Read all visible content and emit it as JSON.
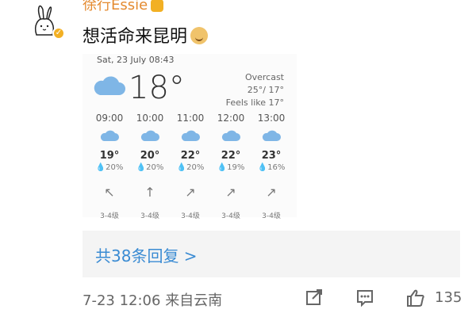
{
  "post": {
    "username": "徐行Essie",
    "comment_text": "想活命来昆明",
    "verified": true
  },
  "weather_card": {
    "date": "Sat, 23 July 08:43",
    "current_temp": "18°",
    "condition": "Overcast",
    "hi_lo": "25°/ 17°",
    "feels_like": "Feels like 17°",
    "hours": [
      {
        "time": "09:00",
        "temp": "19°",
        "rain": "20%",
        "wind_dir": "NW",
        "wind": "3-4级"
      },
      {
        "time": "10:00",
        "temp": "20°",
        "rain": "20%",
        "wind_dir": "N",
        "wind": "3-4级"
      },
      {
        "time": "11:00",
        "temp": "22°",
        "rain": "20%",
        "wind_dir": "NE",
        "wind": "3-4级"
      },
      {
        "time": "12:00",
        "temp": "22°",
        "rain": "19%",
        "wind_dir": "NE",
        "wind": "3-4级"
      },
      {
        "time": "13:00",
        "temp": "23°",
        "rain": "16%",
        "wind_dir": "NE",
        "wind": "3-4级"
      }
    ]
  },
  "replies": {
    "label": "共38条回复 >"
  },
  "meta": {
    "timestamp": "7-23 12:06",
    "location": "来自云南"
  },
  "actions": {
    "like_count": "135"
  },
  "colors": {
    "username": "#e48a2f",
    "link": "#3a8bd3",
    "cloud": "#7fb6e6"
  },
  "icons": [
    "avatar-bunny",
    "verified-badge",
    "cloud-icon",
    "share-icon",
    "comment-icon",
    "like-icon"
  ]
}
